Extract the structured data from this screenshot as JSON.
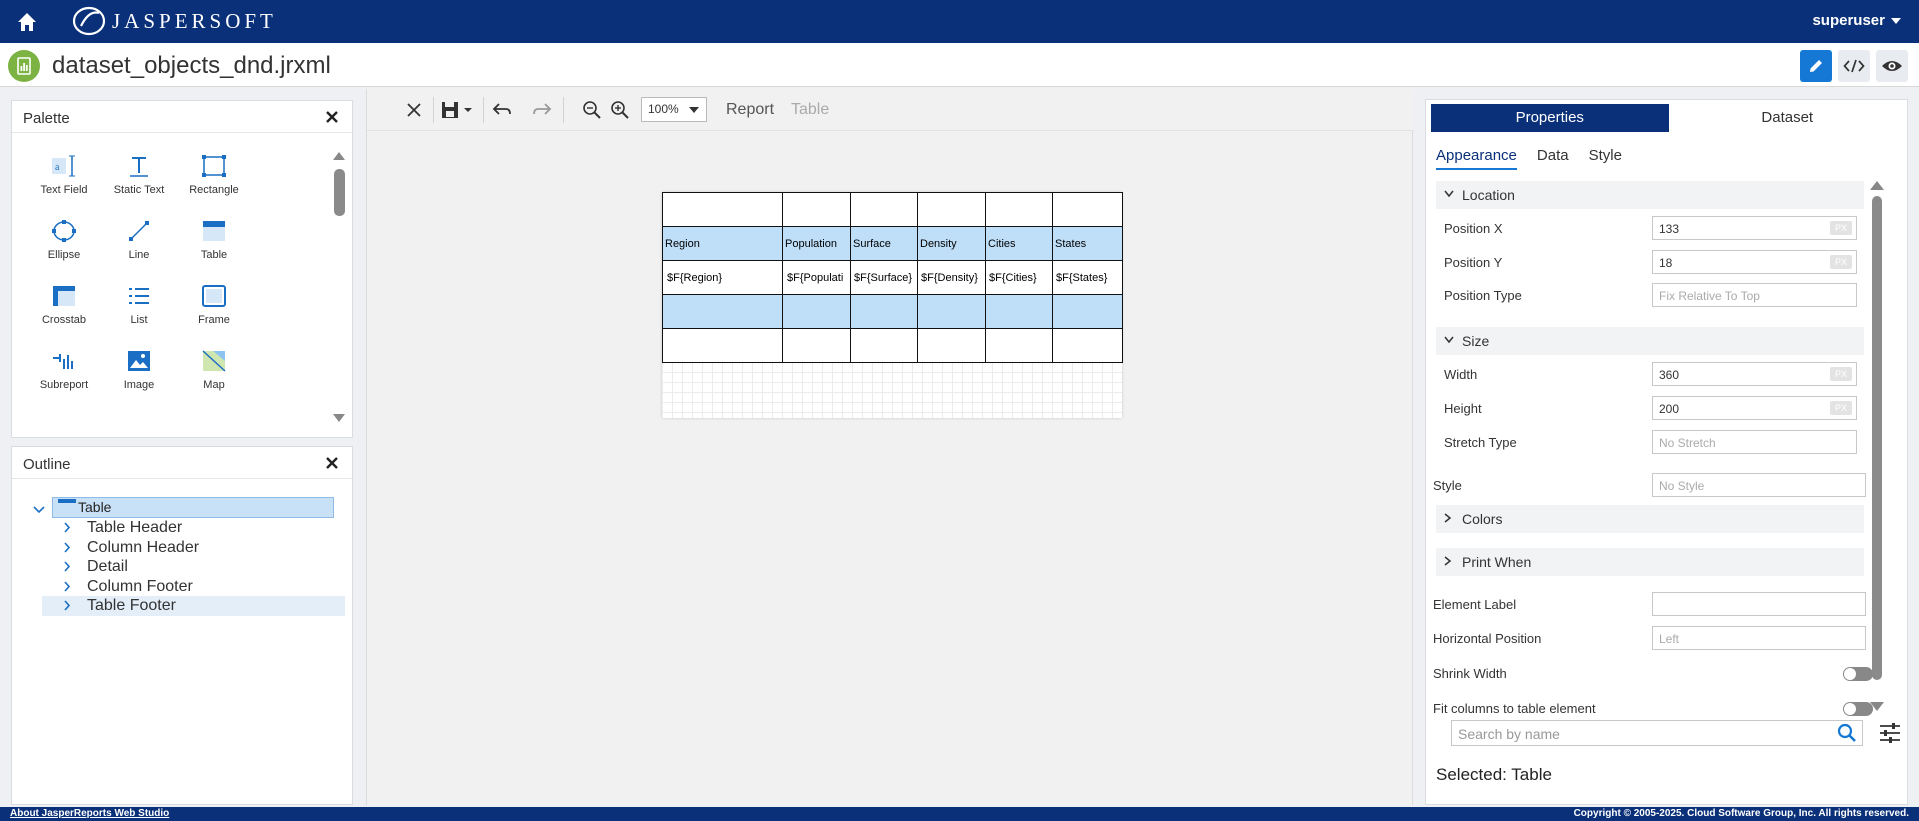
{
  "app": {
    "brand": "JASPERSOFT",
    "user": "superuser",
    "file_name": "dataset_objects_dnd.jrxml"
  },
  "colors": {
    "header_bg": "#0a3079",
    "accent": "#1478d4",
    "table_band": "#bfdff9",
    "file_icon": "#7cb342"
  },
  "palette": {
    "title": "Palette",
    "items": [
      {
        "label": "Text Field",
        "icon": "text-field-icon"
      },
      {
        "label": "Static Text",
        "icon": "static-text-icon"
      },
      {
        "label": "Rectangle",
        "icon": "rectangle-icon"
      },
      {
        "label": "Ellipse",
        "icon": "ellipse-icon"
      },
      {
        "label": "Line",
        "icon": "line-icon"
      },
      {
        "label": "Table",
        "icon": "table-icon"
      },
      {
        "label": "Crosstab",
        "icon": "crosstab-icon"
      },
      {
        "label": "List",
        "icon": "list-icon"
      },
      {
        "label": "Frame",
        "icon": "frame-icon"
      },
      {
        "label": "Subreport",
        "icon": "subreport-icon"
      },
      {
        "label": "Image",
        "icon": "image-icon"
      },
      {
        "label": "Map",
        "icon": "map-icon"
      }
    ]
  },
  "outline": {
    "title": "Outline",
    "root": "Table",
    "children": [
      "Table Header",
      "Column Header",
      "Detail",
      "Column Footer",
      "Table Footer"
    ]
  },
  "toolbar": {
    "zoom": "100%",
    "crumb_report": "Report",
    "crumb_table": "Table"
  },
  "table": {
    "headers": [
      "Region",
      "Population",
      "Surface",
      "Density",
      "Cities",
      "States"
    ],
    "fields": [
      "$F{Region}",
      "$F{Populati",
      "$F{Surface}",
      "$F{Density}",
      "$F{Cities}",
      "$F{States}"
    ]
  },
  "properties": {
    "tab_properties": "Properties",
    "tab_dataset": "Dataset",
    "subtabs": [
      "Appearance",
      "Data",
      "Style"
    ],
    "location": {
      "title": "Location",
      "pos_x_label": "Position X",
      "pos_x": "133",
      "pos_y_label": "Position Y",
      "pos_y": "18",
      "pos_type_label": "Position Type",
      "pos_type": "Fix Relative To Top"
    },
    "size": {
      "title": "Size",
      "width_label": "Width",
      "width": "360",
      "height_label": "Height",
      "height": "200",
      "stretch_label": "Stretch Type",
      "stretch": "No Stretch"
    },
    "unit": "PX",
    "style_label": "Style",
    "style": "No Style",
    "colors_title": "Colors",
    "print_when_title": "Print When",
    "element_label_label": "Element Label",
    "element_label": "",
    "hpos_label": "Horizontal Position",
    "hpos": "Left",
    "shrink_label": "Shrink Width",
    "fit_label": "Fit columns to table element",
    "search_placeholder": "Search by name",
    "selected": "Selected: Table"
  },
  "footer": {
    "about": "About JasperReports Web Studio",
    "copyright": "Copyright © 2005-2025. Cloud Software Group, Inc. All rights reserved."
  }
}
